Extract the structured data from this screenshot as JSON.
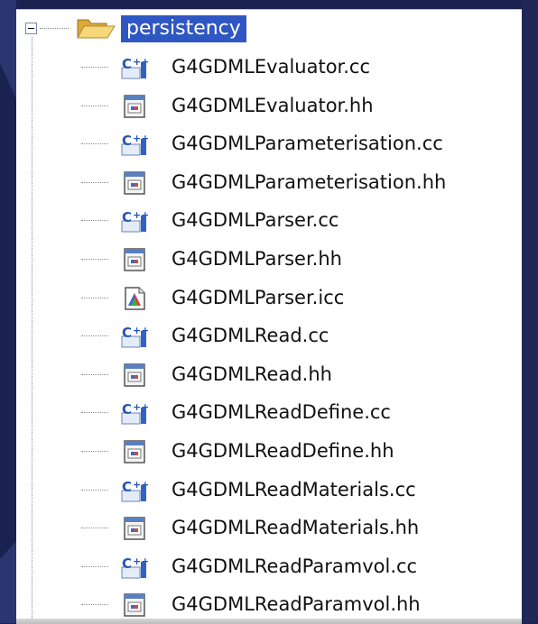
{
  "background_color": "#1b2250",
  "selection_color": "#2f57c4",
  "tree": {
    "folder": {
      "label": "persistency",
      "icon": "folder-open-icon",
      "expanded": true
    },
    "files": [
      {
        "name": "G4GDMLEvaluator.cc",
        "icon": "cpp-source-icon"
      },
      {
        "name": "G4GDMLEvaluator.hh",
        "icon": "header-file-icon"
      },
      {
        "name": "G4GDMLParameterisation.cc",
        "icon": "cpp-source-icon"
      },
      {
        "name": "G4GDMLParameterisation.hh",
        "icon": "header-file-icon"
      },
      {
        "name": "G4GDMLParser.cc",
        "icon": "cpp-source-icon"
      },
      {
        "name": "G4GDMLParser.hh",
        "icon": "header-file-icon"
      },
      {
        "name": "G4GDMLParser.icc",
        "icon": "generic-file-icon"
      },
      {
        "name": "G4GDMLRead.cc",
        "icon": "cpp-source-icon"
      },
      {
        "name": "G4GDMLRead.hh",
        "icon": "header-file-icon"
      },
      {
        "name": "G4GDMLReadDefine.cc",
        "icon": "cpp-source-icon"
      },
      {
        "name": "G4GDMLReadDefine.hh",
        "icon": "header-file-icon"
      },
      {
        "name": "G4GDMLReadMaterials.cc",
        "icon": "cpp-source-icon"
      },
      {
        "name": "G4GDMLReadMaterials.hh",
        "icon": "header-file-icon"
      },
      {
        "name": "G4GDMLReadParamvol.cc",
        "icon": "cpp-source-icon"
      },
      {
        "name": "G4GDMLReadParamvol.hh",
        "icon": "header-file-icon"
      }
    ]
  }
}
